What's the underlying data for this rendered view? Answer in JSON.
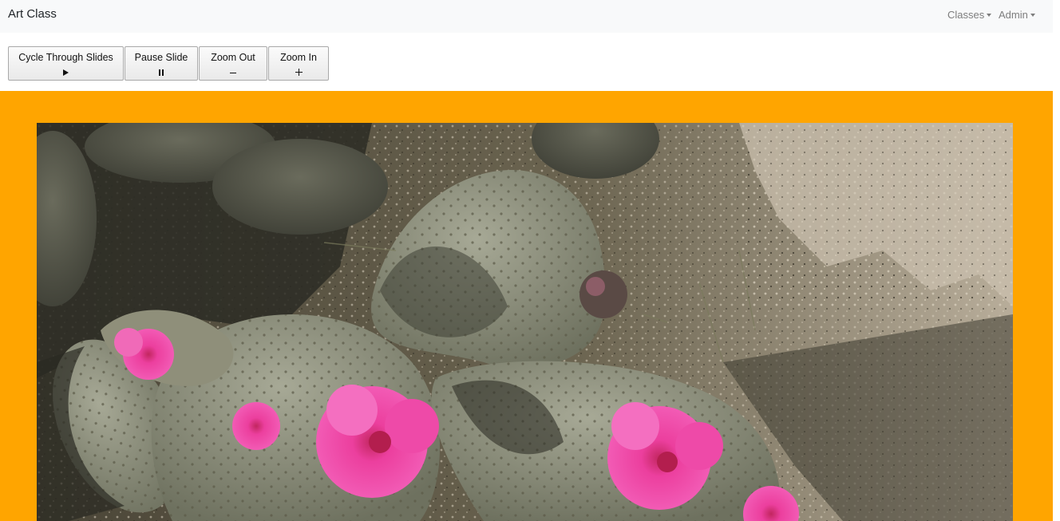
{
  "navbar": {
    "brand": "Art Class",
    "menus": [
      {
        "label": "Classes"
      },
      {
        "label": "Admin"
      }
    ]
  },
  "controls": {
    "cycle": {
      "label": "Cycle Through Slides",
      "icon": "play-icon"
    },
    "pause": {
      "label": "Pause Slide",
      "icon": "pause-icon"
    },
    "zoom_out": {
      "label": "Zoom Out",
      "icon": "minus-icon"
    },
    "zoom_in": {
      "label": "Zoom In",
      "icon": "plus-icon"
    }
  },
  "slide": {
    "subject": "flowering cactus photo",
    "frame_color": "#ffa500"
  }
}
